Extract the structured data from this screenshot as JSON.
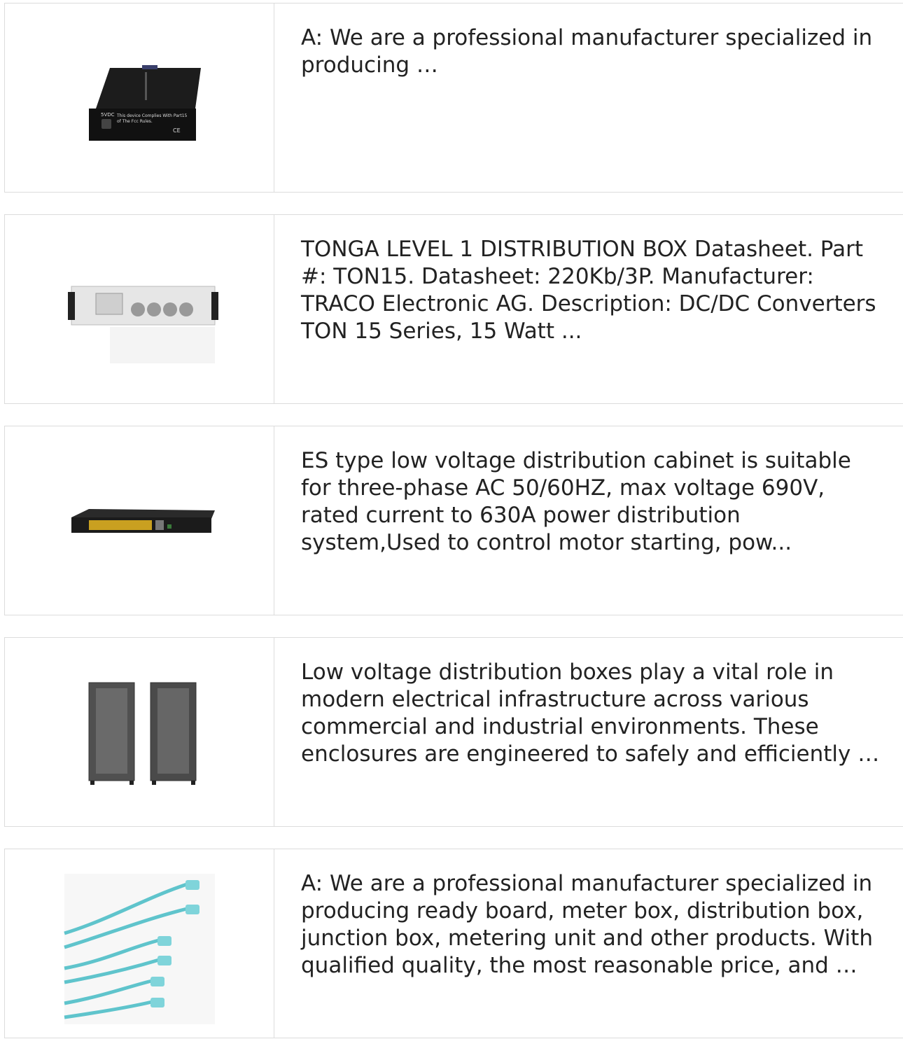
{
  "items": [
    {
      "image_alt": "fiber media converter",
      "snippet": "A: We are a professional manufacturer specialized in producing …",
      "device_labels": {
        "port": "5VDC",
        "notice": "This device Complies With Part15",
        "notice2": "of The Fcc Rules.",
        "mark": "CE"
      }
    },
    {
      "image_alt": "power amplifier rack unit",
      "snippet": "TONGA LEVEL 1 DISTRIBUTION BOX Datasheet. Part #: TON15. Datasheet: 220Kb/3P. Manufacturer: TRACO Electronic AG. Description: DC/DC Converters TON 15 Series, 15 Watt ..."
    },
    {
      "image_alt": "network switch",
      "snippet": "ES type low voltage distribution cabinet is suitable for three-phase AC 50/60HZ, max voltage 690V, rated current to 630A power distribution system,Used to control motor starting, pow..."
    },
    {
      "image_alt": "server cabinets",
      "snippet": "Low voltage distribution boxes play a vital role in modern electrical infrastructure across various commercial and industrial environments. These enclosures are engineered to safely and efficiently …"
    },
    {
      "image_alt": "fiber optic patch cables",
      "snippet": "A: We are a professional manufacturer specialized in producing ready board, meter box, distribution box, junction box, metering unit and other products. With qualified quality, the most reasonable price, and …"
    }
  ]
}
